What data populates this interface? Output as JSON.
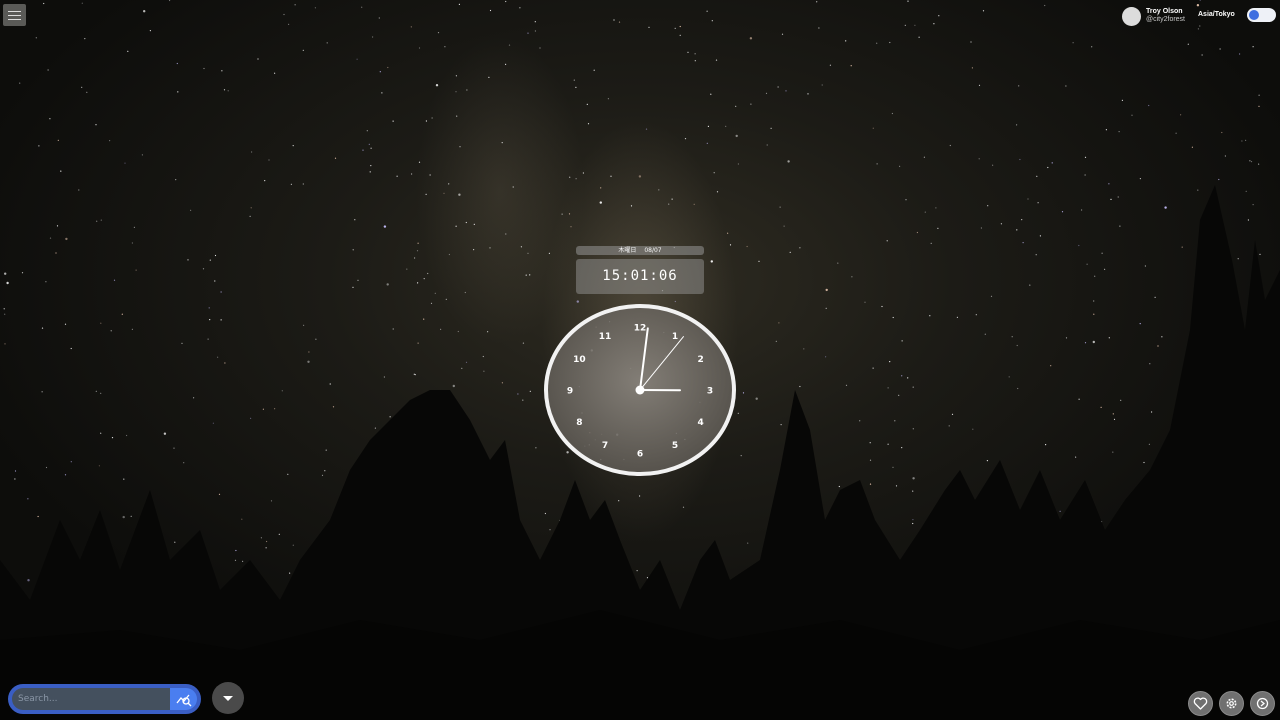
{
  "header": {
    "user": {
      "name": "Troy Olson",
      "handle": "@city2forest"
    },
    "timezone": "Asia/Tokyo",
    "theme_toggle": {
      "on": true,
      "accent": "#3f6fe0"
    }
  },
  "date_bar": {
    "weekday": "木曜日",
    "date": "08/07"
  },
  "digital_clock": {
    "time": "15:01:06"
  },
  "analog_clock": {
    "numbers": [
      "12",
      "1",
      "2",
      "3",
      "4",
      "5",
      "6",
      "7",
      "8",
      "9",
      "10",
      "11"
    ],
    "hours": 15,
    "minutes": 1,
    "seconds": 6
  },
  "search": {
    "placeholder": "Search..."
  },
  "icons": {
    "menu": "hamburger-icon",
    "search_go": "search-trend-icon",
    "dropdown": "caret-down-icon",
    "favorite": "heart-icon",
    "settings": "gear-icon",
    "info": "circle-arrow-icon"
  },
  "colors": {
    "search_accent": "#4a7ef0",
    "clock_face": "#6b6762"
  }
}
